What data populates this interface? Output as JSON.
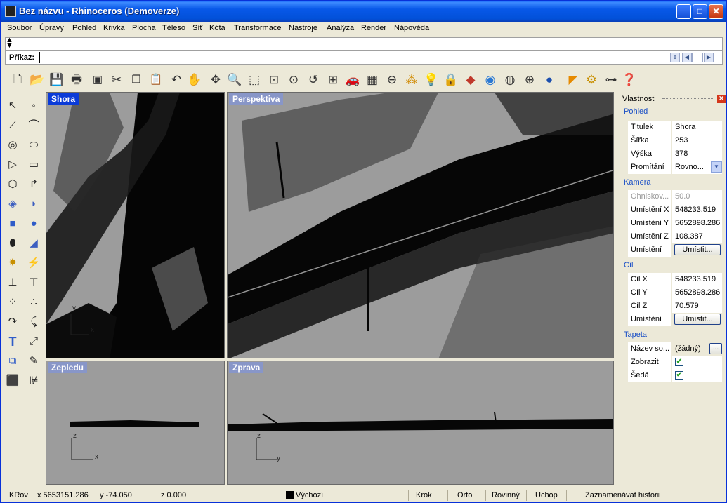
{
  "window": {
    "title": "Bez názvu - Rhinoceros (Demoverze)",
    "min": "_",
    "max": "□",
    "close": "✕"
  },
  "menu": [
    "Soubor",
    "Úpravy",
    "Pohled",
    "Křivka",
    "Plocha",
    "Těleso",
    "Síť",
    "Kóta",
    "Transformace",
    "Nástroje",
    "Analýza",
    "Render",
    "Nápověda"
  ],
  "command": {
    "label": "Příkaz:",
    "value": ""
  },
  "toolbar_icons": [
    "new-file-icon",
    "open-file-icon",
    "save-icon",
    "print-icon",
    "properties-icon",
    "cut-icon",
    "copy-icon",
    "paste-icon",
    "undo-icon",
    "pan-icon",
    "rotate-view-icon",
    "zoom-dynamic-icon",
    "zoom-window-icon",
    "zoom-extents-icon",
    "zoom-selected-icon",
    "undo-view-icon",
    "four-viewports-icon",
    "car-icon",
    "grid-icon",
    "cplane-icon",
    "point-edit-icon",
    "light-icon",
    "lock-icon",
    "layers-icon",
    "color-wheel-icon",
    "sphere-wire-icon",
    "render-preview-icon",
    "render-icon",
    "shade-icon",
    "gear-icon",
    "tree-icon",
    "help-icon"
  ],
  "viewports": {
    "top": {
      "label": "Shora"
    },
    "perspective": {
      "label": "Perspektiva"
    },
    "back": {
      "label": "Zepledu"
    },
    "right": {
      "label": "Zprava"
    }
  },
  "axes": {
    "x": "x",
    "y": "y",
    "z": "z"
  },
  "properties": {
    "title": "Vlastnosti",
    "close": "✕",
    "sections": {
      "view": "Pohled",
      "camera": "Kamera",
      "target": "Cíl",
      "wallpaper": "Tapeta"
    },
    "view_rows": [
      {
        "key": "Titulek",
        "value": "Shora"
      },
      {
        "key": "Šířka",
        "value": "253"
      },
      {
        "key": "Výška",
        "value": "378"
      },
      {
        "key": "Promítání",
        "value": "Rovno..."
      }
    ],
    "camera_rows": [
      {
        "key": "Ohniskov...",
        "value": "50.0"
      },
      {
        "key": "Umístění X",
        "value": "548233.519"
      },
      {
        "key": "Umístění Y",
        "value": "5652898.286"
      },
      {
        "key": "Umístění Z",
        "value": "108.387"
      },
      {
        "key": "Umístění",
        "button": "Umístit..."
      }
    ],
    "target_rows": [
      {
        "key": "Cíl X",
        "value": "548233.519"
      },
      {
        "key": "Cíl Y",
        "value": "5652898.286"
      },
      {
        "key": "Cíl Z",
        "value": "70.579"
      },
      {
        "key": "Umístění",
        "button": "Umístit..."
      }
    ],
    "wallpaper_rows": [
      {
        "key": "Název so...",
        "value": "(žádný)",
        "button": "..."
      },
      {
        "key": "Zobrazit",
        "checked": true
      },
      {
        "key": "Šedá",
        "checked": true
      }
    ]
  },
  "status": {
    "cplane": "KRov",
    "x": "x 5653151.286",
    "y": "y -74.050",
    "z": "z 0.000",
    "layer": "Výchozí",
    "snap": "Krok",
    "ortho": "Orto",
    "planar": "Rovinný",
    "osnap": "Uchop",
    "history": "Zaznamenávat historii"
  },
  "colors": {
    "titlebar": "#0b58e8",
    "active_viewport_label": "#0b3bd8",
    "section_text": "#1a4fc6"
  }
}
